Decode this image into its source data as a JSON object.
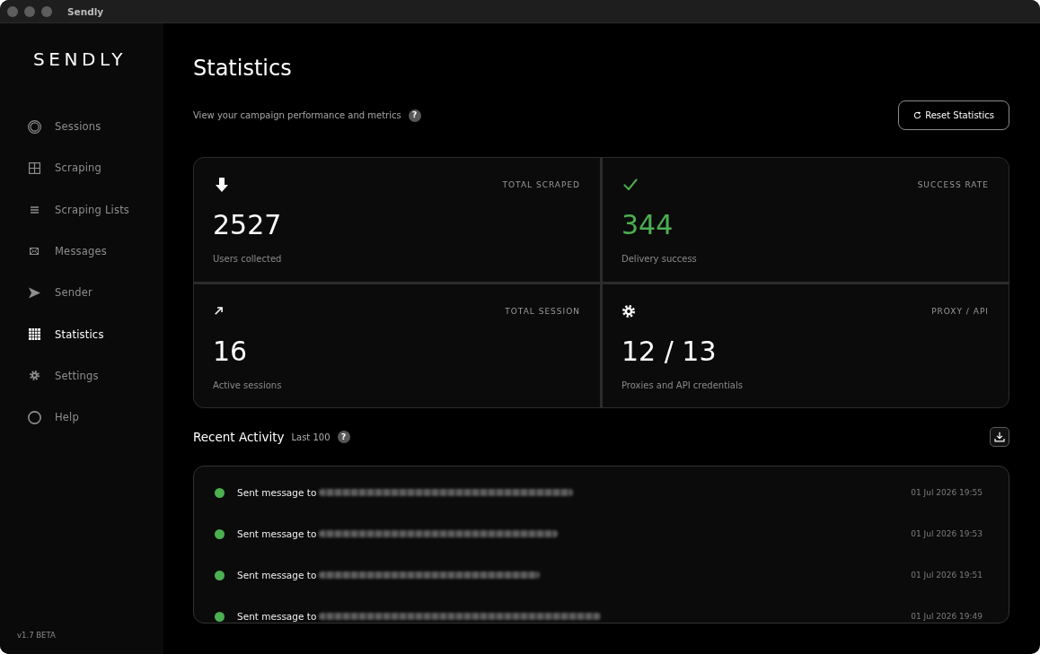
{
  "window": {
    "title": "Sendly"
  },
  "sidebar": {
    "logo": "SENDLY",
    "items": [
      {
        "label": "Sessions",
        "selected": false
      },
      {
        "label": "Scraping",
        "selected": false
      },
      {
        "label": "Scraping Lists",
        "selected": false
      },
      {
        "label": "Messages",
        "selected": false
      },
      {
        "label": "Sender",
        "selected": false
      },
      {
        "label": "Statistics",
        "selected": true
      },
      {
        "label": "Settings",
        "selected": false
      },
      {
        "label": "Help",
        "selected": false
      }
    ],
    "version": "v1.7 BETA"
  },
  "header": {
    "title": "Statistics",
    "subtitle": "View your campaign performance and metrics",
    "help_mark": "?",
    "reset_button": "Reset Statistics"
  },
  "stats": [
    {
      "label": "TOTAL SCRAPED",
      "value": "2527",
      "caption": "Users collected",
      "color": "#ffffff"
    },
    {
      "label": "SUCCESS RATE",
      "value": "344",
      "caption": "Delivery success",
      "color": "#4caf50"
    },
    {
      "label": "TOTAL SESSION",
      "value": "16",
      "caption": "Active sessions",
      "color": "#ffffff"
    },
    {
      "label": "PROXY / API",
      "value": "12 / 13",
      "caption": "Proxies and API credentials",
      "color": "#ffffff"
    }
  ],
  "activity": {
    "title": "Recent Activity",
    "badge": "Last 100",
    "help_mark": "?",
    "rows": [
      {
        "text": "Sent message to",
        "recipient_blurred": true,
        "time": "01 Jul 2026 19:55",
        "color": "#4caf50"
      },
      {
        "text": "Sent message to",
        "recipient_blurred": true,
        "time": "01 Jul 2026 19:53",
        "color": "#4caf50"
      },
      {
        "text": "Sent message to",
        "recipient_blurred": true,
        "time": "01 Jul 2026 19:51",
        "color": "#4caf50"
      },
      {
        "text": "Sent message to",
        "recipient_blurred": true,
        "time": "01 Jul 2026 19:49",
        "color": "#4caf50"
      }
    ]
  }
}
